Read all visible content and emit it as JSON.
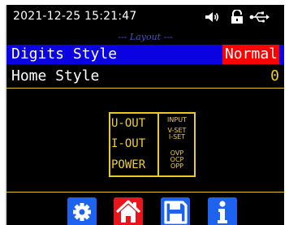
{
  "status": {
    "datetime": "2021-12-25 15:21:47",
    "icons": [
      "speaker-icon",
      "lock-open-icon",
      "usb-icon"
    ]
  },
  "menu": {
    "title": "--- Layout ---",
    "items": [
      {
        "label": "Digits Style",
        "value": "Normal",
        "selected": true
      },
      {
        "label": "Home Style",
        "value": "0",
        "selected": false
      }
    ]
  },
  "preview": {
    "big_labels": [
      "U-OUT",
      "I-OUT",
      "POWER"
    ],
    "small_labels": [
      "INPUT",
      "V-SET",
      "I-SET",
      "OVP",
      "OCP",
      "OPP"
    ]
  },
  "toolbar": {
    "buttons": [
      {
        "name": "settings",
        "icon": "gear-icon"
      },
      {
        "name": "home",
        "icon": "home-icon"
      },
      {
        "name": "save",
        "icon": "save-icon"
      },
      {
        "name": "info",
        "icon": "info-icon"
      }
    ]
  },
  "colors": {
    "background": "#000000",
    "highlight_row": "#0a02e0",
    "value_highlight": "#ff0000",
    "accent_yellow": "#f2d21c",
    "title_blue": "#4b4cc7",
    "button_blue": "#1e63f0",
    "button_red": "#e8161c"
  }
}
